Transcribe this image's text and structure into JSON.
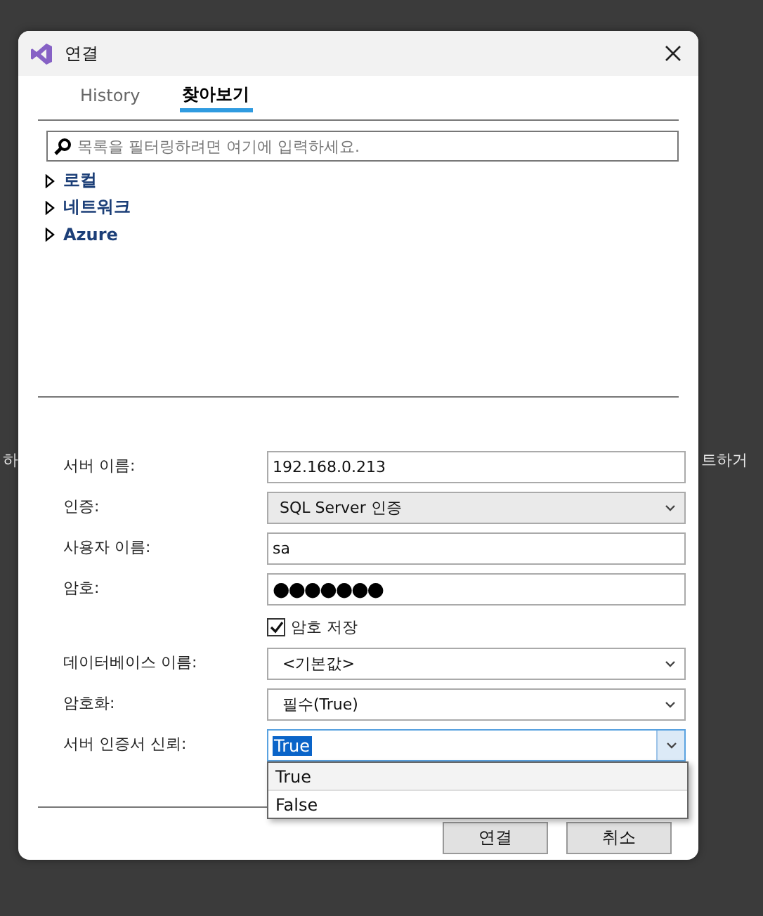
{
  "background_text": {
    "left": "하",
    "right": "트하거"
  },
  "window": {
    "title": "연결"
  },
  "tabs": [
    {
      "label": "History",
      "selected": false
    },
    {
      "label": "찾아보기",
      "selected": true
    }
  ],
  "search": {
    "placeholder": "목록을 필터링하려면 여기에 입력하세요."
  },
  "tree": [
    {
      "label": "로컬",
      "expanded": false
    },
    {
      "label": "네트워크",
      "expanded": false
    },
    {
      "label": "Azure",
      "expanded": false
    }
  ],
  "form": [
    {
      "kind": "text",
      "label": "서버 이름:",
      "value": "192.168.0.213"
    },
    {
      "kind": "select",
      "label": "인증:",
      "value": "SQL Server 인증",
      "shaded": true
    },
    {
      "kind": "text",
      "label": "사용자 이름:",
      "value": "sa"
    },
    {
      "kind": "password",
      "label": "암호:",
      "value": "●●●●●●●"
    },
    {
      "kind": "checkbox",
      "label": "암호 저장",
      "checked": true
    },
    {
      "kind": "select",
      "label": "데이터베이스 이름:",
      "value": "<기본값>"
    },
    {
      "kind": "select",
      "label": "암호화:",
      "value": "필수(True)"
    },
    {
      "kind": "combo",
      "label": "서버 인증서 신뢰:",
      "value": "True",
      "open": true,
      "options": [
        {
          "label": "True",
          "selected": true
        },
        {
          "label": "False",
          "selected": false
        }
      ]
    }
  ],
  "buttons": [
    "연결",
    "취소"
  ]
}
